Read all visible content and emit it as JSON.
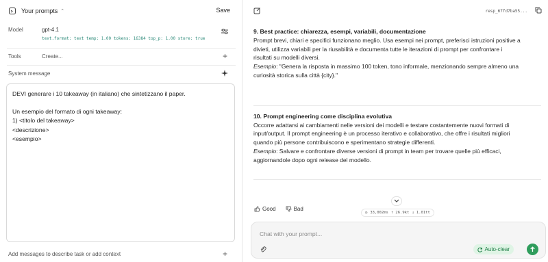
{
  "header": {
    "title": "Your prompts",
    "save_label": "Save"
  },
  "model": {
    "label": "Model",
    "name": "gpt-4.1",
    "params": "text.format: text temp: 1.00 tokens: 16384 top_p: 1.00 store: true"
  },
  "tools": {
    "label": "Tools",
    "create_label": "Create..."
  },
  "system": {
    "label": "System message",
    "lines": [
      "DEVI generare i 10 takeaway (in italiano) che sintetizzano il paper.",
      "",
      "Un esempio del formato di ogni takeaway:",
      "1) <titolo del takeaway>",
      "<descrizione>",
      "<esempio>"
    ]
  },
  "add_messages_label": "Add messages to describe task or add context",
  "response": {
    "id": "resp_67fd7ba55...",
    "items": [
      {
        "title": "9. Best practice: chiarezza, esempi, variabili, documentazione",
        "lines": [
          "Prompt brevi, chiari e specifici funzionano meglio. Usa esempi nei prompt, preferisci istruzioni positive a",
          "divieti, utilizza variabili per la riusabilità e documenta tutte le iterazioni di prompt per confrontare i",
          "risultati su modelli diversi."
        ],
        "example_label": "Esempio",
        "example_lines": [
          ": \"Genera la risposta in massimo 100 token, tono informale, menzionando sempre almeno una",
          "curiosità storica sulla città {city}.\""
        ]
      },
      {
        "title": "10. Prompt engineering come disciplina evolutiva",
        "lines": [
          "Occorre adattarsi ai cambiamenti nelle versioni dei modelli e testare costantemente nuovi formati di",
          "input/output. Il prompt engineering è un processo iterativo e collaborativo, che offre i risultati migliori",
          "quando più persone contribuiscono e sperimentano strategie differenti."
        ],
        "example_label": "Esempio",
        "example_lines": [
          ": Salvare e confrontare diverse versioni di prompt in team per trovare quelle più efficaci,",
          "aggiornandole dopo ogni release del modello."
        ]
      }
    ],
    "feedback": {
      "good": "Good",
      "bad": "Bad"
    },
    "stats": {
      "time": "33,002ms",
      "tokens_in": "↑ 26.9kt",
      "tokens_out": "↓ 1.01tt"
    }
  },
  "chat": {
    "placeholder": "Chat with your prompt...",
    "autoclear_label": "Auto-clear"
  }
}
